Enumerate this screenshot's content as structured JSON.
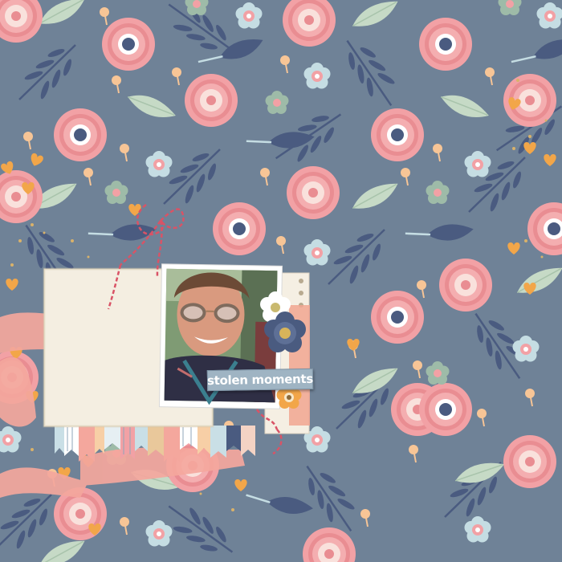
{
  "layout": {
    "title_tag": {
      "text": "stolen moments"
    }
  },
  "colors": {
    "background": "#6f8297",
    "flower_pink": "#f2a1a5",
    "flower_pink_dark": "#e78489",
    "flower_center": "#f9e1dc",
    "small_flower_blue": "#c5dde3",
    "navy": "#4a5b80",
    "leaf_mint": "#c6dac6",
    "berry": "#f7c596",
    "heart_orange": "#f2a649",
    "card_cream": "#f4eee1",
    "paint_coral": "#f4a79d",
    "twine_red": "#d95366"
  },
  "icons": {
    "pattern": [
      "large-pink-flower-icon",
      "small-blue-flower-icon",
      "navy-flower-icon",
      "mint-leaf-icon",
      "navy-leaf-icon",
      "navy-branch-icon",
      "berry-stem-icon"
    ],
    "embellishments": [
      "orange-heart-icon",
      "twine-bow-icon",
      "paper-flower-icon",
      "button-flower-icon",
      "fabric-banner-icon"
    ]
  }
}
